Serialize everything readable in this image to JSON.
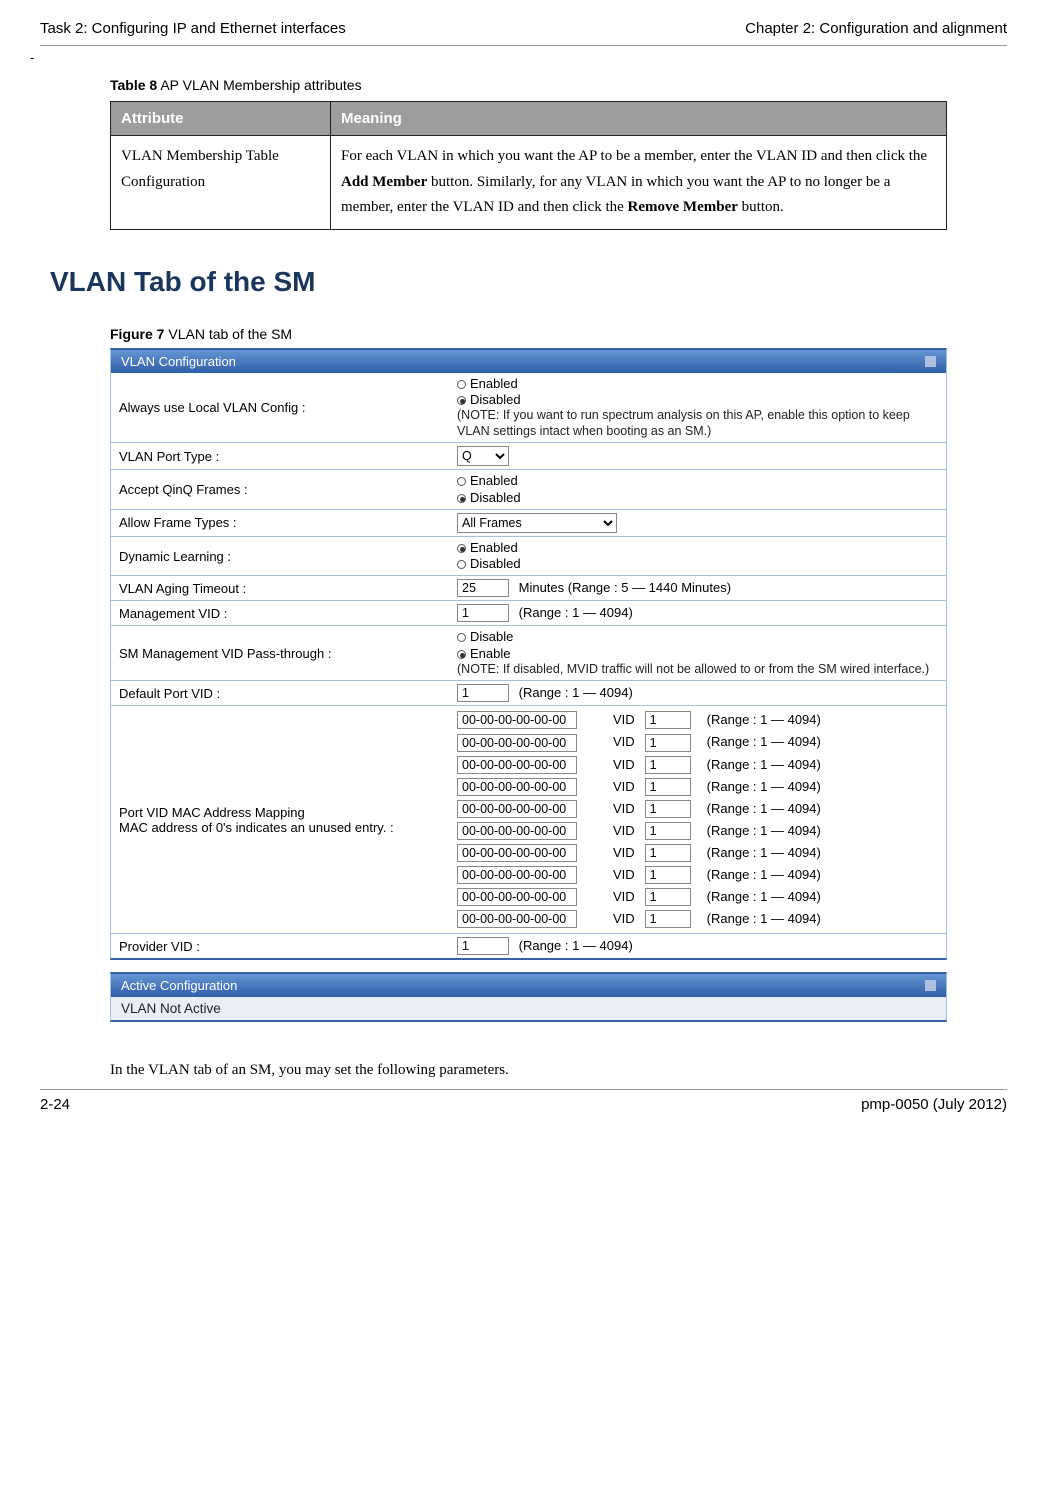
{
  "header": {
    "left": "Task 2: Configuring IP and Ethernet interfaces",
    "right": "Chapter 2:  Configuration and alignment"
  },
  "dash": "-",
  "table8": {
    "caption_bold": "Table 8",
    "caption_rest": "  AP VLAN Membership attributes",
    "headers": {
      "col1": "Attribute",
      "col2": "Meaning"
    },
    "row": {
      "attribute": "VLAN Membership Table Configuration",
      "meaning_parts": {
        "p1": "For each VLAN in which you want the AP to be a member, enter the VLAN ID and then click the ",
        "b1": "Add Member",
        "p2": " button. Similarly, for any VLAN in which you want the AP to no longer be a member, enter the VLAN ID and then click the ",
        "b2": "Remove Member",
        "p3": " button."
      }
    }
  },
  "section_heading": "VLAN Tab of the SM",
  "figure_caption_bold": "Figure 7",
  "figure_caption_rest": "  VLAN tab of the SM",
  "panel_title": "VLAN Configuration",
  "labels": {
    "always_local": "Always use Local VLAN Config :",
    "port_type": "VLAN Port Type :",
    "qinq": "Accept QinQ Frames :",
    "allow_frames": "Allow Frame Types :",
    "dyn_learn": "Dynamic Learning :",
    "aging": "VLAN Aging Timeout :",
    "mgmt_vid": "Management VID :",
    "passthrough": "SM Management VID Pass-through :",
    "default_port_vid": "Default Port VID :",
    "mac_mapping": "Port VID MAC Address Mapping\nMAC address of 0's indicates an unused entry. :",
    "provider_vid": "Provider VID :"
  },
  "radio": {
    "enabled": "Enabled",
    "disabled": "Disabled",
    "enable": "Enable",
    "disable": "Disable"
  },
  "notes": {
    "local_note": "(NOTE: If you want to run spectrum analysis on this AP, enable this option to keep VLAN settings intact when booting as an SM.)",
    "pass_note": "(NOTE: If disabled, MVID traffic will not be allowed to or from the SM wired interface.)"
  },
  "inputs": {
    "port_type": "Q",
    "allow_frames": "All Frames",
    "aging_val": "25",
    "aging_range": "Minutes (Range : 5 — 1440 Minutes)",
    "mgmt_vid_val": "1",
    "range_1_4094": "(Range : 1 — 4094)",
    "default_port_vid_val": "1",
    "mac_default": "00-00-00-00-00-00",
    "vid_label": "VID",
    "vid_val": "1",
    "provider_vid_val": "1"
  },
  "mac_rows": [
    0,
    1,
    2,
    3,
    4,
    5,
    6,
    7,
    8,
    9
  ],
  "active_panel_title": "Active Configuration",
  "not_active_text": "VLAN Not Active",
  "bottom_para": "In the VLAN tab of an SM, you may set the following parameters.",
  "footer": {
    "left": "2-24",
    "right": "pmp-0050 (July 2012)"
  }
}
